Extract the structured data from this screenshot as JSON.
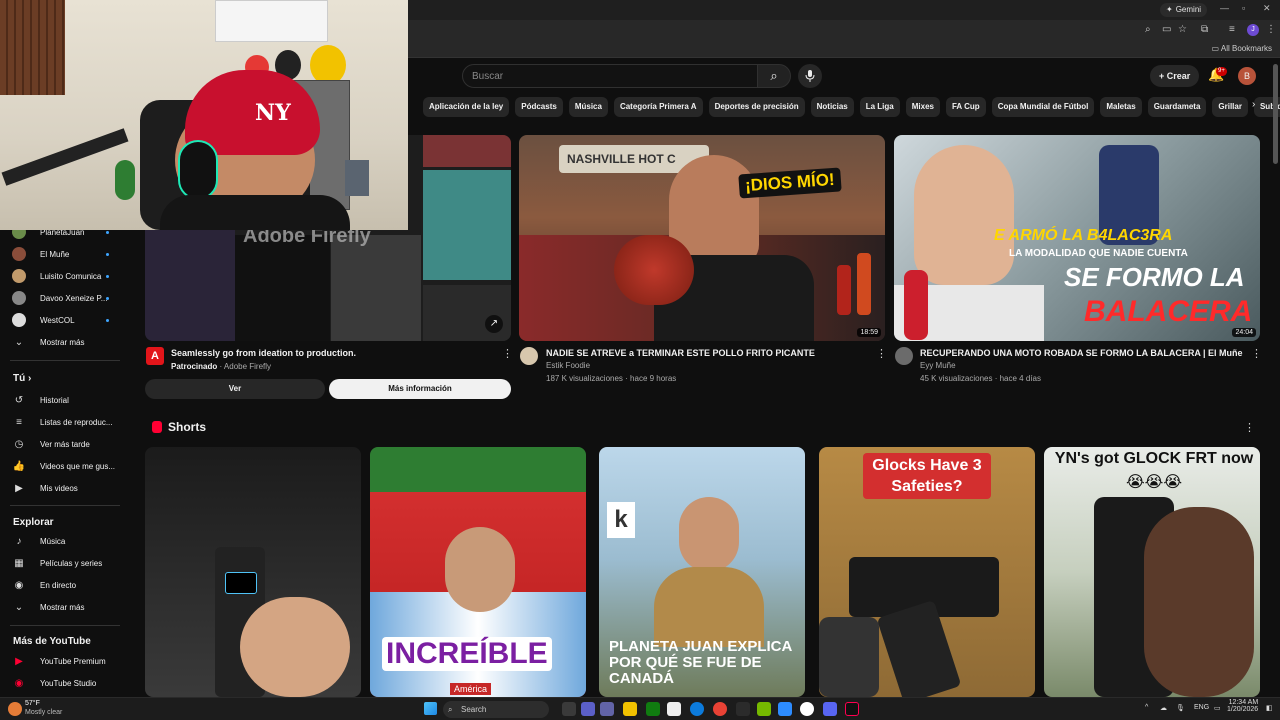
{
  "browser": {
    "gemini_label": "Gemini",
    "bookmarks_label": "All Bookmarks",
    "profile_initial": "J"
  },
  "youtube": {
    "search_placeholder": "Buscar",
    "create_label": "Crear",
    "notif_badge": "9+",
    "avatar_initial": "B",
    "chips": [
      "Aplicación de la ley",
      "Pódcasts",
      "Música",
      "Categoría Primera A",
      "Deportes de precisión",
      "Noticias",
      "La Liga",
      "Mixes",
      "FA Cup",
      "Copa Mundial de Fútbol",
      "Maletas",
      "Guardameta",
      "Grillar",
      "Subida"
    ]
  },
  "sidebar": {
    "channels": [
      "PlanetaJuan",
      "El Muñe",
      "Luisito Comunica",
      "Davoo Xeneize P...",
      "WestCOL"
    ],
    "show_more_1": "Mostrar más",
    "you_heading": "Tú",
    "you_items": [
      "Historial",
      "Listas de reproduc...",
      "Ver más tarde",
      "Videos que me gus...",
      "Mis videos"
    ],
    "explore_heading": "Explorar",
    "explore_items": [
      "Música",
      "Películas y series",
      "En directo"
    ],
    "show_more_2": "Mostrar más",
    "more_heading": "Más de YouTube",
    "more_items": [
      "YouTube Premium",
      "YouTube Studio"
    ]
  },
  "ad": {
    "thumb_text": "Adobe Firefly",
    "title": "Seamlessly go from ideation to production.",
    "sponsored": "Patrocinado",
    "advertiser": "Adobe Firefly",
    "btn_view": "Ver",
    "btn_more": "Más información"
  },
  "videos": [
    {
      "title": "NADIE SE ATREVE a TERMINAR ESTE POLLO FRITO PICANTE",
      "channel": "Estik Foodie",
      "meta": "187 K visualizaciones · hace 9 horas",
      "duration": "18:59",
      "thumb_text": "¡DIOS MÍO!",
      "sign_text": "NASHVILLE HOT C"
    },
    {
      "title": "RECUPERANDO UNA MOTO ROBADA SE FORMO LA BALACERA | El Muñe",
      "channel": "Eyy Muñe",
      "meta": "45 K visualizaciones · hace 4 días",
      "duration": "24:04",
      "thumb_line1": "E ARMÓ LA B4LAC3RA",
      "thumb_line2": "LA MODALIDAD QUE NADIE CUENTA",
      "thumb_line3": "SE FORMO LA",
      "thumb_line4": "BALACERA"
    }
  ],
  "shorts": {
    "heading": "Shorts",
    "items": [
      {
        "text": ""
      },
      {
        "text": "INCREÍBLE",
        "sub": "América"
      },
      {
        "text": "PLANETA JUAN EXPLICA POR QUÉ SE FUE DE CANADÁ"
      },
      {
        "text": "Glocks Have 3 Safeties?"
      },
      {
        "text": "YN's got GLOCK FRT now 😭😭😭"
      }
    ]
  },
  "taskbar": {
    "weather_temp": "57°F",
    "weather_desc": "Mostly clear",
    "search_label": "Search",
    "lang": "ENG",
    "time": "12:34 AM",
    "date": "1/20/2026"
  }
}
